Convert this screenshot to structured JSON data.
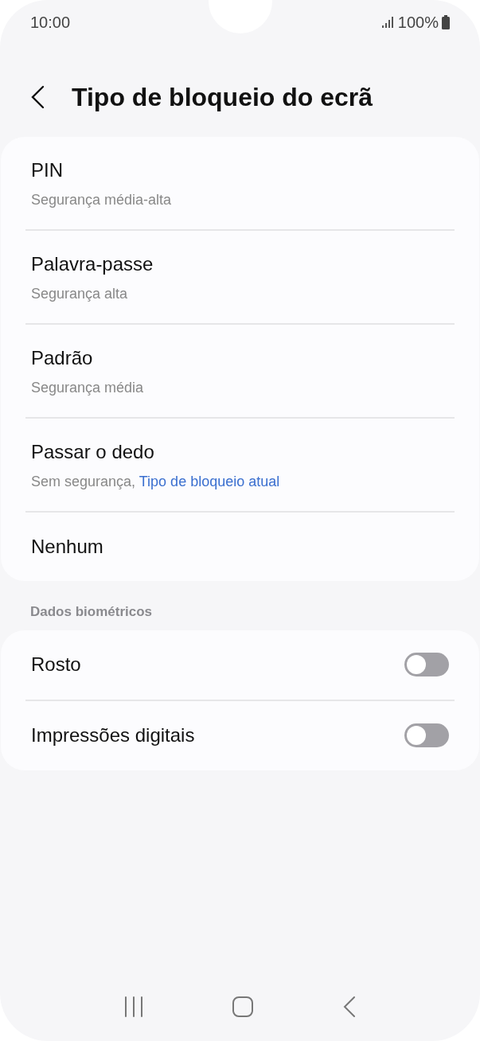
{
  "status_bar": {
    "time": "10:00",
    "battery": "100%"
  },
  "header": {
    "title": "Tipo de bloqueio do ecrã"
  },
  "lock_types": [
    {
      "title": "PIN",
      "subtitle": "Segurança média-alta"
    },
    {
      "title": "Palavra-passe",
      "subtitle": "Segurança alta"
    },
    {
      "title": "Padrão",
      "subtitle": "Segurança média"
    },
    {
      "title": "Passar o dedo",
      "subtitle": "Sem segurança,",
      "subtitle_link": "Tipo de bloqueio atual"
    },
    {
      "title": "Nenhum"
    }
  ],
  "biometrics": {
    "heading": "Dados biométricos",
    "items": [
      {
        "label": "Rosto",
        "on": false
      },
      {
        "label": "Impressões digitais",
        "on": false
      }
    ]
  }
}
